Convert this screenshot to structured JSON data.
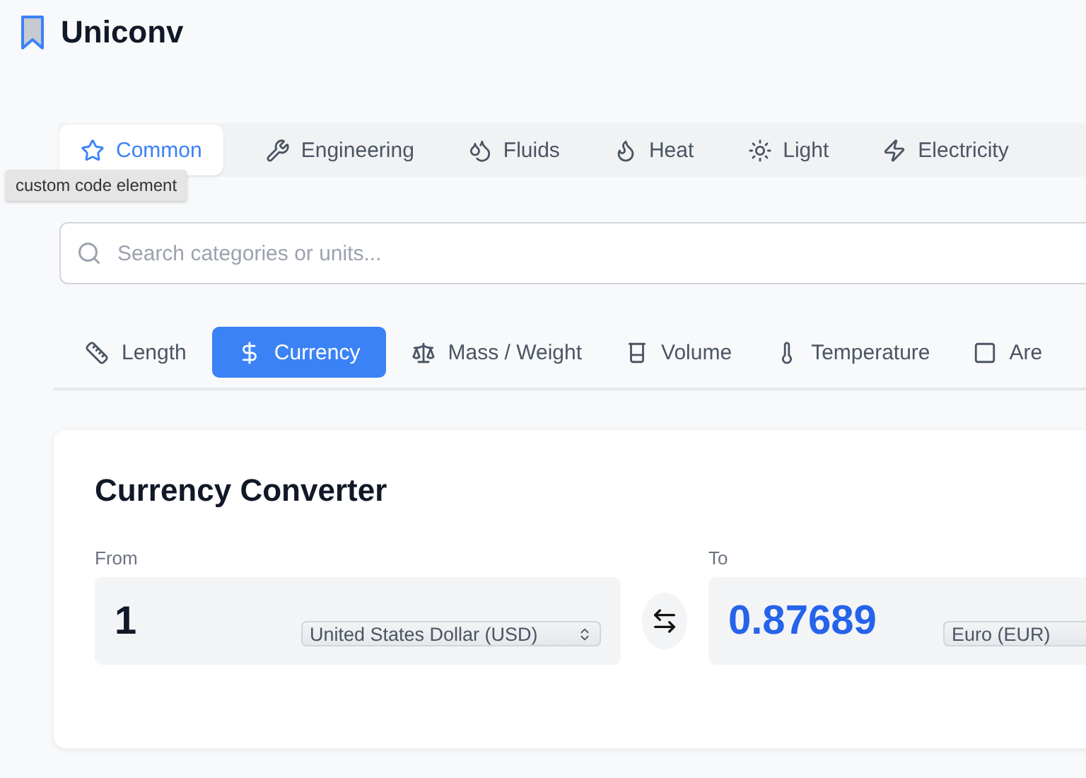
{
  "app": {
    "title": "Uniconv"
  },
  "category_tabs": [
    {
      "label": "Common",
      "selected": true
    },
    {
      "label": "Engineering",
      "selected": false
    },
    {
      "label": "Fluids",
      "selected": false
    },
    {
      "label": "Heat",
      "selected": false
    },
    {
      "label": "Light",
      "selected": false
    },
    {
      "label": "Electricity",
      "selected": false
    }
  ],
  "tooltip": "custom code element",
  "search": {
    "placeholder": "Search categories or units..."
  },
  "unit_tabs": [
    {
      "label": "Length",
      "selected": false
    },
    {
      "label": "Currency",
      "selected": true
    },
    {
      "label": "Mass / Weight",
      "selected": false
    },
    {
      "label": "Volume",
      "selected": false
    },
    {
      "label": "Temperature",
      "selected": false
    },
    {
      "label": "Are",
      "selected": false
    }
  ],
  "converter": {
    "title": "Currency Converter",
    "from": {
      "label": "From",
      "value": "1",
      "unit": "United States Dollar (USD)"
    },
    "to": {
      "label": "To",
      "value": "0.87689",
      "unit": "Euro (EUR)"
    }
  }
}
